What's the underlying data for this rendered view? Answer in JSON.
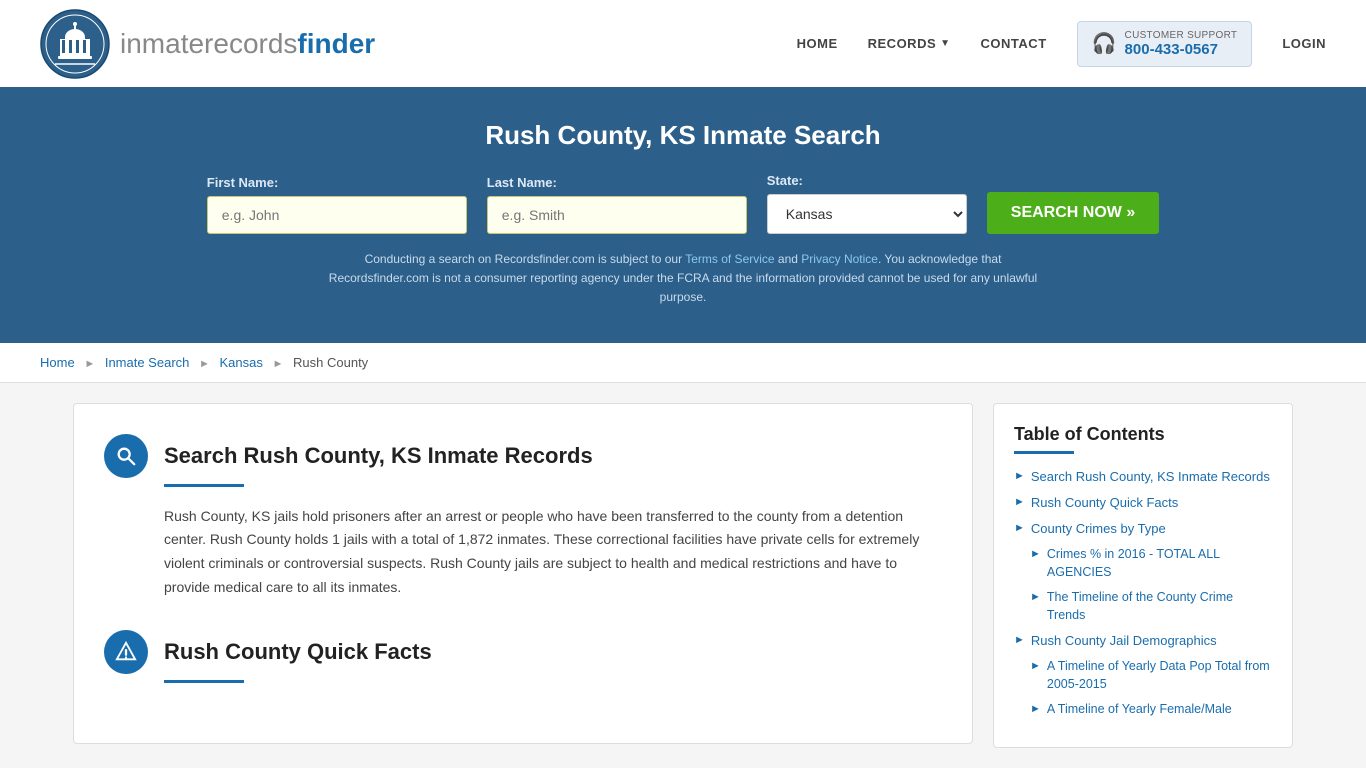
{
  "header": {
    "logo_text_normal": "inmaterecords",
    "logo_text_bold": "finder",
    "nav": {
      "home": "HOME",
      "records": "RECORDS",
      "contact": "CONTACT",
      "login": "LOGIN",
      "support_label": "CUSTOMER SUPPORT",
      "support_number": "800-433-0567"
    }
  },
  "hero": {
    "title": "Rush County, KS Inmate Search",
    "first_name_label": "First Name:",
    "first_name_placeholder": "e.g. John",
    "last_name_label": "Last Name:",
    "last_name_placeholder": "e.g. Smith",
    "state_label": "State:",
    "state_value": "Kansas",
    "search_button": "SEARCH NOW »",
    "disclaimer": "Conducting a search on Recordsfinder.com is subject to our Terms of Service and Privacy Notice. You acknowledge that Recordsfinder.com is not a consumer reporting agency under the FCRA and the information provided cannot be used for any unlawful purpose."
  },
  "breadcrumb": {
    "home": "Home",
    "inmate_search": "Inmate Search",
    "kansas": "Kansas",
    "current": "Rush County"
  },
  "content": {
    "section1": {
      "title": "Search Rush County, KS Inmate Records",
      "body": "Rush County, KS jails hold prisoners after an arrest or people who have been transferred to the county from a detention center. Rush County holds 1 jails with a total of 1,872 inmates. These correctional facilities have private cells for extremely violent criminals or controversial suspects. Rush County jails are subject to health and medical restrictions and have to provide medical care to all its inmates."
    },
    "section2": {
      "title": "Rush County Quick Facts"
    }
  },
  "toc": {
    "title": "Table of Contents",
    "items": [
      {
        "label": "Search Rush County, KS Inmate Records",
        "sub": false
      },
      {
        "label": "Rush County Quick Facts",
        "sub": false
      },
      {
        "label": "County Crimes by Type",
        "sub": false
      },
      {
        "label": "Crimes % in 2016 - TOTAL ALL AGENCIES",
        "sub": true
      },
      {
        "label": "The Timeline of the County Crime Trends",
        "sub": true
      },
      {
        "label": "Rush County Jail Demographics",
        "sub": false
      },
      {
        "label": "A Timeline of Yearly Data Pop Total from 2005-2015",
        "sub": true
      },
      {
        "label": "A Timeline of Yearly Female/Male",
        "sub": true
      }
    ]
  }
}
